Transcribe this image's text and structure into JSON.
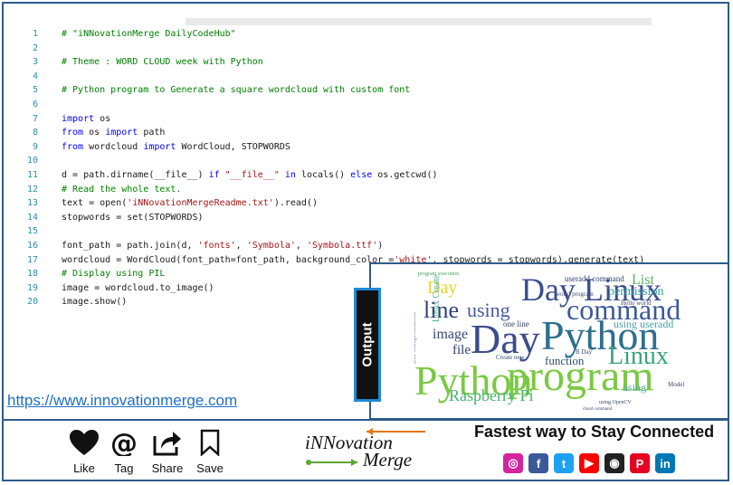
{
  "code": {
    "lines": [
      {
        "n": "1",
        "parts": [
          {
            "t": "# \"iNNovationMerge DailyCodeHub\"",
            "c": "cm"
          }
        ]
      },
      {
        "n": "2",
        "parts": []
      },
      {
        "n": "3",
        "parts": [
          {
            "t": "# Theme : WORD CLOUD week with Python",
            "c": "cm"
          }
        ]
      },
      {
        "n": "4",
        "parts": []
      },
      {
        "n": "5",
        "parts": [
          {
            "t": "# Python program to Generate a square wordcloud with custom font",
            "c": "cm"
          }
        ]
      },
      {
        "n": "6",
        "parts": []
      },
      {
        "n": "7",
        "parts": [
          {
            "t": "import",
            "c": "kw"
          },
          {
            "t": " os",
            "c": "src"
          }
        ]
      },
      {
        "n": "8",
        "parts": [
          {
            "t": "from",
            "c": "kw"
          },
          {
            "t": " os ",
            "c": "src"
          },
          {
            "t": "import",
            "c": "kw"
          },
          {
            "t": " path",
            "c": "src"
          }
        ]
      },
      {
        "n": "9",
        "parts": [
          {
            "t": "from",
            "c": "kw"
          },
          {
            "t": " wordcloud ",
            "c": "src"
          },
          {
            "t": "import",
            "c": "kw"
          },
          {
            "t": " WordCloud, STOPWORDS",
            "c": "src"
          }
        ]
      },
      {
        "n": "10",
        "parts": []
      },
      {
        "n": "11",
        "parts": [
          {
            "t": "d = path.dirname(__file__) ",
            "c": "src"
          },
          {
            "t": "if",
            "c": "kw"
          },
          {
            "t": " ",
            "c": "src"
          },
          {
            "t": "\"__file__\"",
            "c": "st"
          },
          {
            "t": " ",
            "c": "src"
          },
          {
            "t": "in",
            "c": "kw"
          },
          {
            "t": " locals() ",
            "c": "src"
          },
          {
            "t": "else",
            "c": "kw"
          },
          {
            "t": " os.getcwd()",
            "c": "src"
          }
        ]
      },
      {
        "n": "12",
        "parts": [
          {
            "t": "# Read the whole text.",
            "c": "cm"
          }
        ]
      },
      {
        "n": "13",
        "parts": [
          {
            "t": "text = open(",
            "c": "src"
          },
          {
            "t": "'iNNovationMergeReadme.txt'",
            "c": "st"
          },
          {
            "t": ").read()",
            "c": "src"
          }
        ]
      },
      {
        "n": "14",
        "parts": [
          {
            "t": "stopwords = set(STOPWORDS)",
            "c": "src"
          }
        ]
      },
      {
        "n": "15",
        "parts": []
      },
      {
        "n": "16",
        "parts": [
          {
            "t": "font_path = path.join(d, ",
            "c": "src"
          },
          {
            "t": "'fonts'",
            "c": "st"
          },
          {
            "t": ", ",
            "c": "src"
          },
          {
            "t": "'Symbola'",
            "c": "st"
          },
          {
            "t": ", ",
            "c": "src"
          },
          {
            "t": "'Symbola.ttf'",
            "c": "st"
          },
          {
            "t": ")",
            "c": "src"
          }
        ]
      },
      {
        "n": "17",
        "parts": [
          {
            "t": "wordcloud = WordCloud(font_path=font_path, background_color =",
            "c": "src"
          },
          {
            "t": "'white'",
            "c": "st"
          },
          {
            "t": ", stopwords = stopwords).generate(text)",
            "c": "src"
          }
        ]
      },
      {
        "n": "18",
        "parts": [
          {
            "t": "# Display using PIL",
            "c": "cm"
          }
        ]
      },
      {
        "n": "19",
        "parts": [
          {
            "t": "image = wordcloud.to_image()",
            "c": "src"
          }
        ]
      },
      {
        "n": "20",
        "parts": [
          {
            "t": "image.show()",
            "c": "src"
          }
        ]
      }
    ]
  },
  "url": "https://www.innovationmerge.com",
  "output_label": "Output",
  "wordcloud": {
    "words": [
      {
        "w": "Day Linux",
        "color": "#3a4f8c"
      },
      {
        "w": "command line",
        "color": "#3b5998"
      },
      {
        "w": "Day",
        "color": "#3c4d8a"
      },
      {
        "w": "Python",
        "color": "#2d6f8e"
      },
      {
        "w": "Python",
        "color": "#7ac943"
      },
      {
        "w": "program",
        "color": "#7ac943"
      },
      {
        "w": "line",
        "color": "#34407a"
      },
      {
        "w": "using",
        "color": "#4a5aa0"
      },
      {
        "w": "Day",
        "color": "#e6d52a"
      },
      {
        "w": "Linux",
        "color": "#38a37a"
      },
      {
        "w": "List",
        "color": "#57b65a"
      },
      {
        "w": "permission",
        "color": "#35a0a0"
      },
      {
        "w": "Raspberry Pi",
        "color": "#45b36d"
      },
      {
        "w": "function",
        "color": "#2f4f6f"
      },
      {
        "w": "image",
        "color": "#3a4a7a"
      },
      {
        "w": "file",
        "color": "#2f3f6f"
      },
      {
        "w": "one line",
        "color": "#2f3f5f"
      },
      {
        "w": "Linux Create",
        "color": "#4cae8c"
      },
      {
        "w": "using useradd",
        "color": "#4aa0a0"
      },
      {
        "w": "Create new",
        "color": "#2f4f6f"
      },
      {
        "w": "B Day",
        "color": "#3a4a6a"
      },
      {
        "w": "using",
        "color": "#4aaa9a"
      },
      {
        "w": "useradd command",
        "color": "#2f3f6f"
      },
      {
        "w": "program execution",
        "color": "#4aa05a"
      },
      {
        "w": "world program",
        "color": "#3a4a6a"
      },
      {
        "w": "Hello world",
        "color": "#3a4a6a"
      },
      {
        "w": "Model B",
        "color": "#3a4a6a"
      },
      {
        "w": "List Comprehension",
        "color": "#3b5aa0"
      },
      {
        "w": "using OpenCV",
        "color": "#3a4a6a"
      },
      {
        "w": "cloud command",
        "color": "#3a4a6a"
      }
    ]
  },
  "actions": [
    {
      "label": "Like",
      "icon": "heart-icon"
    },
    {
      "label": "Tag",
      "icon": "at-icon"
    },
    {
      "label": "Share",
      "icon": "share-icon"
    },
    {
      "label": "Save",
      "icon": "bookmark-icon"
    }
  ],
  "logo": {
    "line1": "iNNovation",
    "line2": "Merge"
  },
  "tagline": "Fastest way to Stay Connected",
  "social": [
    {
      "name": "instagram-icon",
      "glyph": "◎",
      "color": "#d6249f"
    },
    {
      "name": "facebook-icon",
      "glyph": "f",
      "color": "#3b5998"
    },
    {
      "name": "twitter-icon",
      "glyph": "t",
      "color": "#1da1f2"
    },
    {
      "name": "youtube-icon",
      "glyph": "▶",
      "color": "#ff0000"
    },
    {
      "name": "github-icon",
      "glyph": "◉",
      "color": "#222222"
    },
    {
      "name": "pinterest-icon",
      "glyph": "P",
      "color": "#e60023"
    },
    {
      "name": "linkedin-icon",
      "glyph": "in",
      "color": "#0077b5"
    }
  ]
}
